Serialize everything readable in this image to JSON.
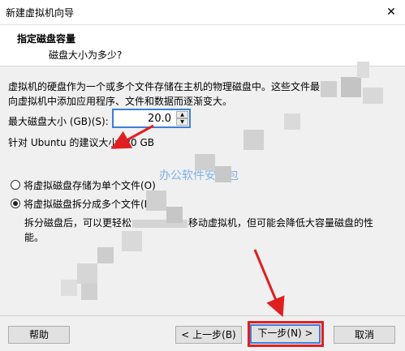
{
  "window": {
    "title": "新建虚拟机向导",
    "close_glyph": "✕"
  },
  "header": {
    "title": "指定磁盘容量",
    "subtitle": "磁盘大小为多少?"
  },
  "body": {
    "description_line1": "虚拟机的硬盘作为一个或多个文件存储在主机的物理磁盘中。这些文件最",
    "description_line2": "向虚拟机中添加应用程序、文件和数据而逐渐变大。",
    "max_size_label": "最大磁盘大小 (GB)(S):",
    "max_size_value": "20.0",
    "recommend_text": "针对 Ubuntu 的建议大小: 20 GB"
  },
  "options": {
    "single_file": {
      "label": "将虚拟磁盘存储为单个文件(O)",
      "selected": false
    },
    "multi_file": {
      "label": "将虚拟磁盘拆分成多个文件(M)",
      "selected": true
    },
    "split_desc_part1": "拆分磁盘后，可以更轻松",
    "split_desc_part2": "移动虚拟机，但可能会降低大容量磁盘的性",
    "split_desc_line2": "能。"
  },
  "watermark": "办公软件安装包",
  "footer": {
    "help": "帮助",
    "back": "< 上一步(B)",
    "next": "下一步(N) >",
    "cancel": "取消"
  },
  "colors": {
    "accent": "#3c7fd8",
    "annotation_red": "#e02020",
    "watermark": "#7fb0e8"
  },
  "icons": {
    "close": "close-icon",
    "spin_up": "spin-up-icon",
    "spin_down": "spin-down-icon"
  }
}
